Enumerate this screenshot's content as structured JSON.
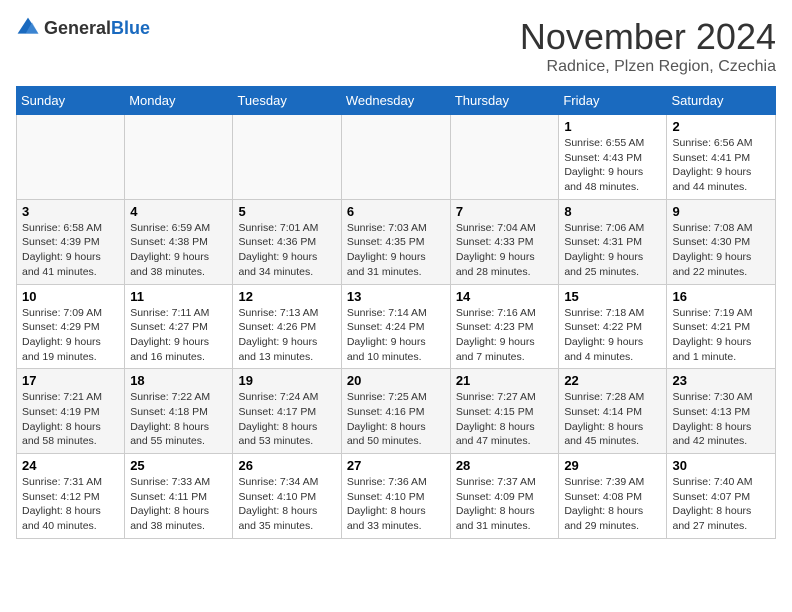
{
  "logo": {
    "general": "General",
    "blue": "Blue"
  },
  "title": "November 2024",
  "location": "Radnice, Plzen Region, Czechia",
  "days_of_week": [
    "Sunday",
    "Monday",
    "Tuesday",
    "Wednesday",
    "Thursday",
    "Friday",
    "Saturday"
  ],
  "weeks": [
    [
      {
        "day": "",
        "info": ""
      },
      {
        "day": "",
        "info": ""
      },
      {
        "day": "",
        "info": ""
      },
      {
        "day": "",
        "info": ""
      },
      {
        "day": "",
        "info": ""
      },
      {
        "day": "1",
        "info": "Sunrise: 6:55 AM\nSunset: 4:43 PM\nDaylight: 9 hours and 48 minutes."
      },
      {
        "day": "2",
        "info": "Sunrise: 6:56 AM\nSunset: 4:41 PM\nDaylight: 9 hours and 44 minutes."
      }
    ],
    [
      {
        "day": "3",
        "info": "Sunrise: 6:58 AM\nSunset: 4:39 PM\nDaylight: 9 hours and 41 minutes."
      },
      {
        "day": "4",
        "info": "Sunrise: 6:59 AM\nSunset: 4:38 PM\nDaylight: 9 hours and 38 minutes."
      },
      {
        "day": "5",
        "info": "Sunrise: 7:01 AM\nSunset: 4:36 PM\nDaylight: 9 hours and 34 minutes."
      },
      {
        "day": "6",
        "info": "Sunrise: 7:03 AM\nSunset: 4:35 PM\nDaylight: 9 hours and 31 minutes."
      },
      {
        "day": "7",
        "info": "Sunrise: 7:04 AM\nSunset: 4:33 PM\nDaylight: 9 hours and 28 minutes."
      },
      {
        "day": "8",
        "info": "Sunrise: 7:06 AM\nSunset: 4:31 PM\nDaylight: 9 hours and 25 minutes."
      },
      {
        "day": "9",
        "info": "Sunrise: 7:08 AM\nSunset: 4:30 PM\nDaylight: 9 hours and 22 minutes."
      }
    ],
    [
      {
        "day": "10",
        "info": "Sunrise: 7:09 AM\nSunset: 4:29 PM\nDaylight: 9 hours and 19 minutes."
      },
      {
        "day": "11",
        "info": "Sunrise: 7:11 AM\nSunset: 4:27 PM\nDaylight: 9 hours and 16 minutes."
      },
      {
        "day": "12",
        "info": "Sunrise: 7:13 AM\nSunset: 4:26 PM\nDaylight: 9 hours and 13 minutes."
      },
      {
        "day": "13",
        "info": "Sunrise: 7:14 AM\nSunset: 4:24 PM\nDaylight: 9 hours and 10 minutes."
      },
      {
        "day": "14",
        "info": "Sunrise: 7:16 AM\nSunset: 4:23 PM\nDaylight: 9 hours and 7 minutes."
      },
      {
        "day": "15",
        "info": "Sunrise: 7:18 AM\nSunset: 4:22 PM\nDaylight: 9 hours and 4 minutes."
      },
      {
        "day": "16",
        "info": "Sunrise: 7:19 AM\nSunset: 4:21 PM\nDaylight: 9 hours and 1 minute."
      }
    ],
    [
      {
        "day": "17",
        "info": "Sunrise: 7:21 AM\nSunset: 4:19 PM\nDaylight: 8 hours and 58 minutes."
      },
      {
        "day": "18",
        "info": "Sunrise: 7:22 AM\nSunset: 4:18 PM\nDaylight: 8 hours and 55 minutes."
      },
      {
        "day": "19",
        "info": "Sunrise: 7:24 AM\nSunset: 4:17 PM\nDaylight: 8 hours and 53 minutes."
      },
      {
        "day": "20",
        "info": "Sunrise: 7:25 AM\nSunset: 4:16 PM\nDaylight: 8 hours and 50 minutes."
      },
      {
        "day": "21",
        "info": "Sunrise: 7:27 AM\nSunset: 4:15 PM\nDaylight: 8 hours and 47 minutes."
      },
      {
        "day": "22",
        "info": "Sunrise: 7:28 AM\nSunset: 4:14 PM\nDaylight: 8 hours and 45 minutes."
      },
      {
        "day": "23",
        "info": "Sunrise: 7:30 AM\nSunset: 4:13 PM\nDaylight: 8 hours and 42 minutes."
      }
    ],
    [
      {
        "day": "24",
        "info": "Sunrise: 7:31 AM\nSunset: 4:12 PM\nDaylight: 8 hours and 40 minutes."
      },
      {
        "day": "25",
        "info": "Sunrise: 7:33 AM\nSunset: 4:11 PM\nDaylight: 8 hours and 38 minutes."
      },
      {
        "day": "26",
        "info": "Sunrise: 7:34 AM\nSunset: 4:10 PM\nDaylight: 8 hours and 35 minutes."
      },
      {
        "day": "27",
        "info": "Sunrise: 7:36 AM\nSunset: 4:10 PM\nDaylight: 8 hours and 33 minutes."
      },
      {
        "day": "28",
        "info": "Sunrise: 7:37 AM\nSunset: 4:09 PM\nDaylight: 8 hours and 31 minutes."
      },
      {
        "day": "29",
        "info": "Sunrise: 7:39 AM\nSunset: 4:08 PM\nDaylight: 8 hours and 29 minutes."
      },
      {
        "day": "30",
        "info": "Sunrise: 7:40 AM\nSunset: 4:07 PM\nDaylight: 8 hours and 27 minutes."
      }
    ]
  ]
}
